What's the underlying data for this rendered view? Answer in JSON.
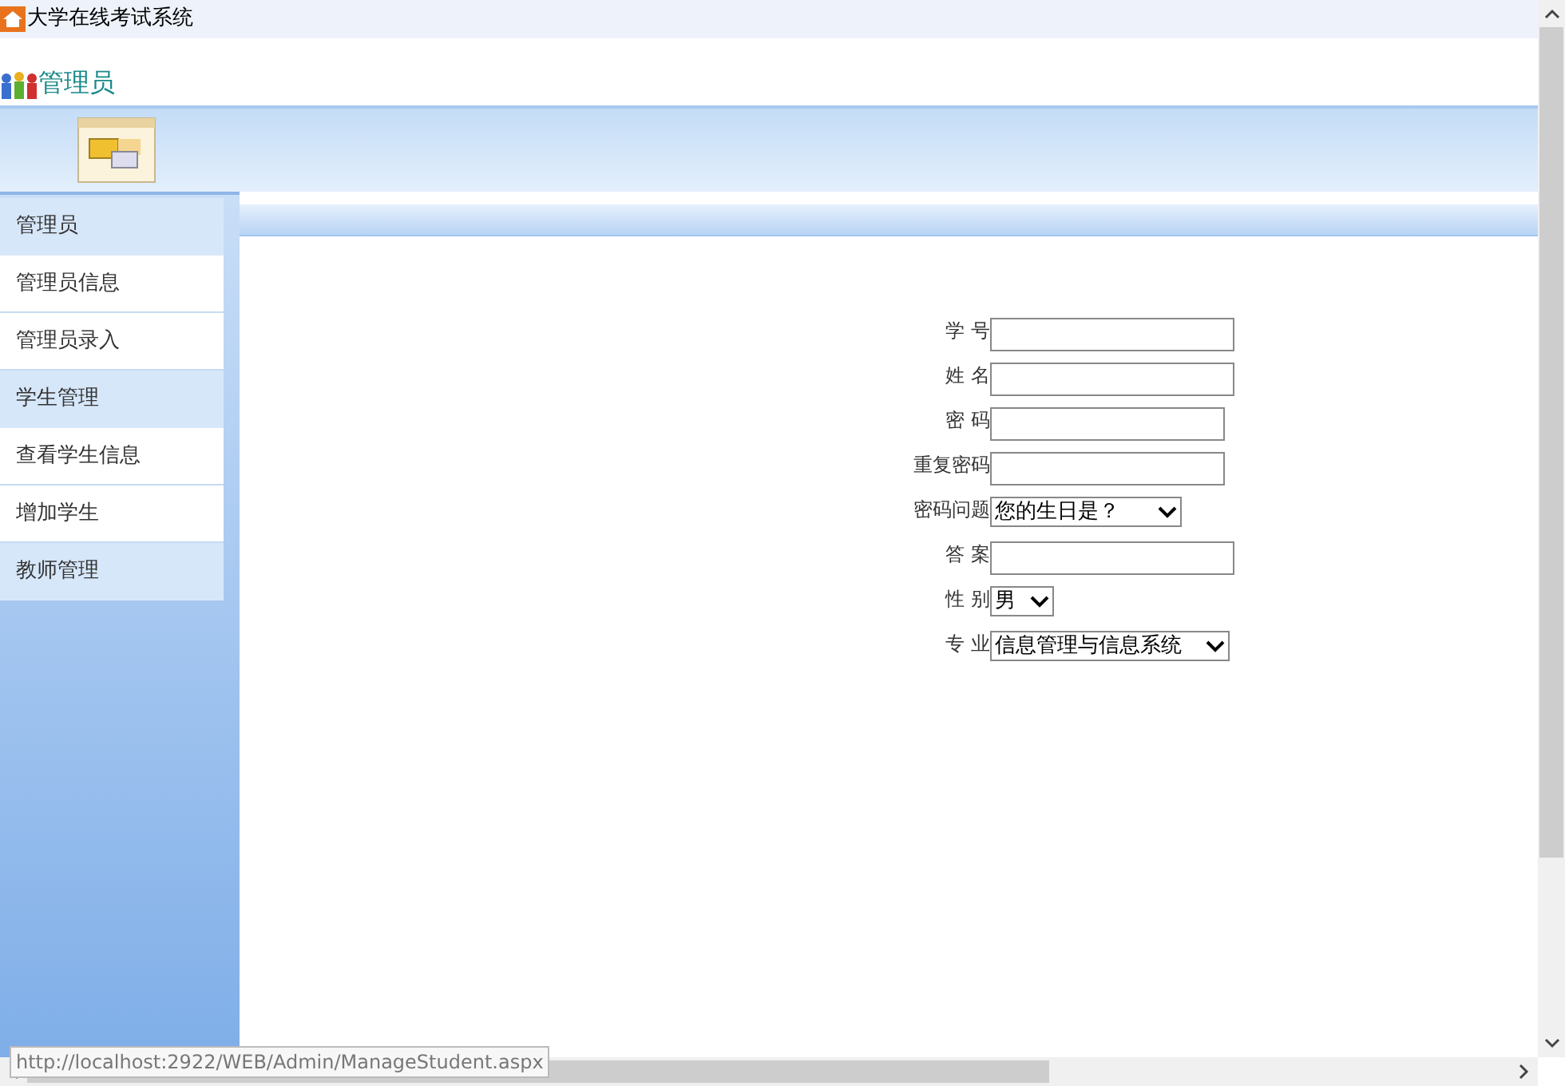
{
  "window": {
    "title": "大学在线考试系统"
  },
  "header": {
    "title": "管理员"
  },
  "sidebar": {
    "items": [
      {
        "kind": "section",
        "label": "管理员"
      },
      {
        "kind": "link",
        "label": "管理员信息"
      },
      {
        "kind": "link",
        "label": "管理员录入"
      },
      {
        "kind": "section",
        "label": "学生管理"
      },
      {
        "kind": "link",
        "label": "查看学生信息"
      },
      {
        "kind": "link",
        "label": "增加学生"
      },
      {
        "kind": "section",
        "label": "教师管理"
      }
    ]
  },
  "form": {
    "fields": [
      {
        "kind": "input",
        "label": "学 号"
      },
      {
        "kind": "input",
        "label": "姓 名"
      },
      {
        "kind": "input",
        "label": "密 码"
      },
      {
        "kind": "input",
        "label": "重复密码"
      },
      {
        "kind": "select",
        "label": "密码问题",
        "value": "您的生日是？"
      },
      {
        "kind": "input",
        "label": "答 案"
      },
      {
        "kind": "select",
        "label": "性 别",
        "value": "男"
      },
      {
        "kind": "select",
        "label": "专 业",
        "value": "信息管理与信息系统"
      }
    ]
  },
  "status_bar": {
    "url": "http://localhost:2922/WEB/Admin/ManageStudent.aspx"
  }
}
